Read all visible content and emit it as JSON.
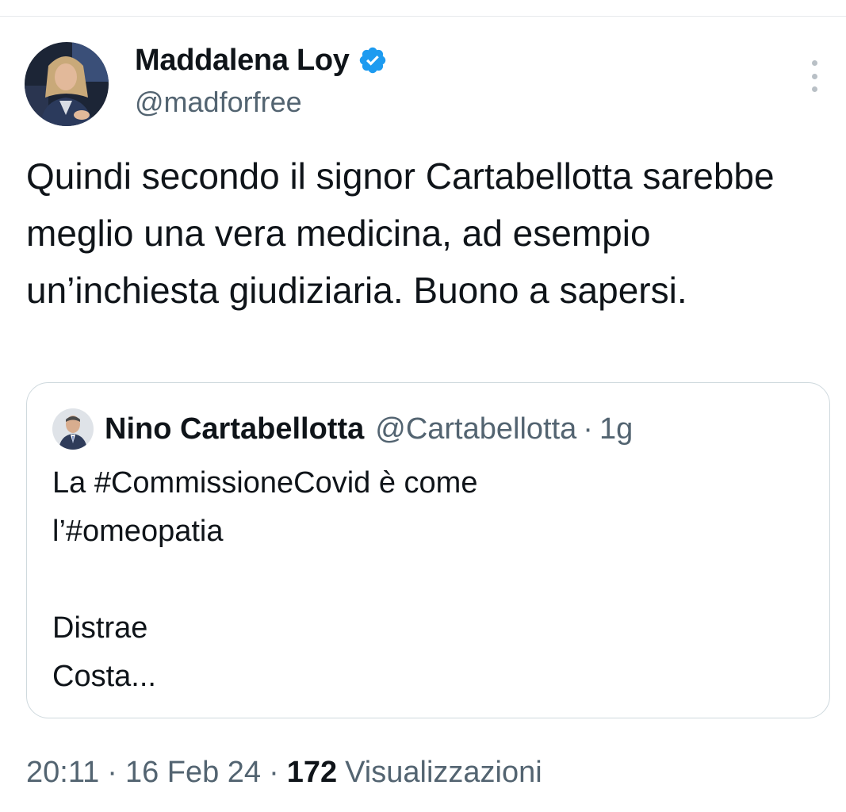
{
  "tweet": {
    "author": {
      "display_name": "Maddalena Loy",
      "handle": "@madforfree",
      "verified": true,
      "verified_color": "#1d9bf0"
    },
    "text": "Quindi secondo il signor Cartabellotta sarebbe meglio una vera medicina, ad esempio un’inchiesta giudiziaria. Buono a sapersi.",
    "quoted_tweet": {
      "author_name": "Nino Cartabellotta",
      "author_handle": "@Cartabellotta",
      "separator": "·",
      "time": "1g",
      "lines": [
        "La #CommissioneCovid è come",
        "l’#omeopatia",
        "",
        "Distrae",
        "Costa..."
      ]
    },
    "meta": {
      "time": "20:11",
      "date": "16 Feb 24",
      "separator": "·",
      "views_count": "172",
      "views_label": "Visualizzazioni"
    }
  },
  "icons": {
    "more": "more-vertical-icon",
    "verified": "verified-badge-icon"
  },
  "colors": {
    "text_primary": "#0f1419",
    "text_secondary": "#536471",
    "border": "#cfd9de",
    "accent": "#1d9bf0"
  }
}
